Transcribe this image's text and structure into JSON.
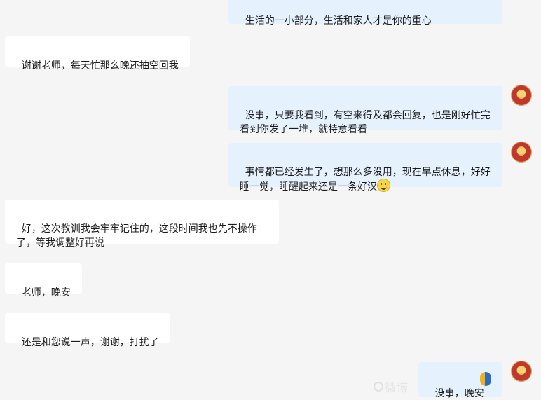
{
  "messages": [
    {
      "side": "right",
      "text": "生活的一小部分，生活和家人才是你的重心"
    },
    {
      "side": "left",
      "text": "谢谢老师，每天忙那么晚还抽空回我"
    },
    {
      "side": "right",
      "text": "没事，只要我看到，有空来得及都会回复，也是刚好忙完看到你发了一堆，就特意看看"
    },
    {
      "side": "right",
      "text": "事情都已经发生了，想那么多没用，现在早点休息，好好睡一觉，睡醒起来还是一条好汉"
    },
    {
      "side": "left",
      "text": "好，这次教训我会牢牢记住的，这段时间我也先不操作了，等我调整好再说"
    },
    {
      "side": "left",
      "text": "老师，晚安"
    },
    {
      "side": "left",
      "text": "还是和您说一声，谢谢，打扰了"
    },
    {
      "side": "right",
      "text": "没事，晚安"
    }
  ],
  "icons": {
    "avatar": "avatar-gold-ingot",
    "emoji": "smile-emoji"
  },
  "watermark": "微博"
}
